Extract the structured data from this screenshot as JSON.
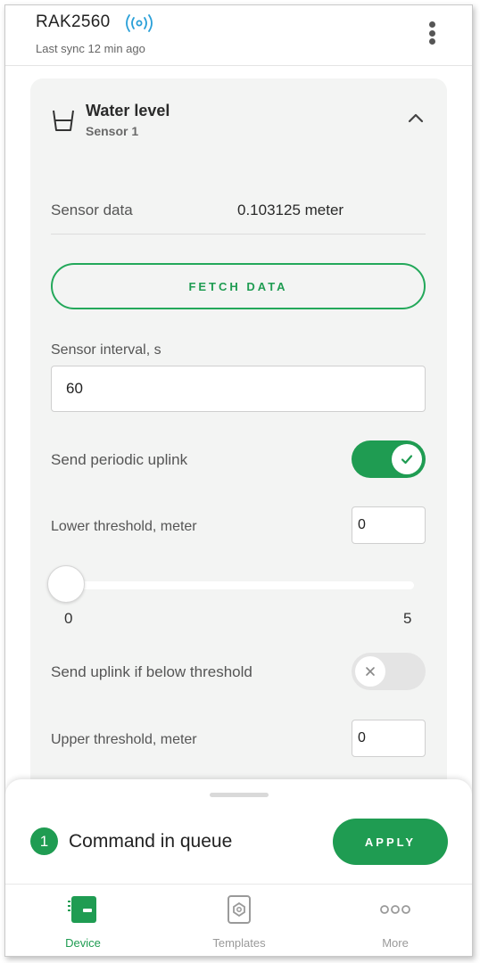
{
  "header": {
    "device_name": "RAK2560",
    "last_sync": "Last sync 12 min ago",
    "status_icon": "signal-broadcast-icon",
    "menu_icon": "more-vert-icon"
  },
  "card": {
    "icon": "water-cup-icon",
    "title": "Water level",
    "subtitle": "Sensor 1",
    "sensor_data_label": "Sensor data",
    "sensor_data_value": "0.103125 meter",
    "fetch_label": "FETCH DATA",
    "interval_label": "Sensor interval, s",
    "interval_value": "60",
    "periodic_label": "Send periodic uplink",
    "periodic_enabled": true,
    "lower_label": "Lower threshold, meter",
    "lower_value": "0",
    "slider_min": "0",
    "slider_max": "5",
    "slider_value": 0,
    "below_label": "Send uplink if below threshold",
    "below_enabled": false,
    "upper_label": "Upper threshold, meter",
    "upper_value": "0"
  },
  "queue": {
    "count": "1",
    "text": "Command in queue",
    "apply_label": "APPLY"
  },
  "nav": {
    "device": "Device",
    "templates": "Templates",
    "more": "More",
    "active": "Device"
  },
  "colors": {
    "accent": "#1f9c52",
    "signal": "#2aa0d8",
    "card_bg": "#f3f4f3"
  }
}
